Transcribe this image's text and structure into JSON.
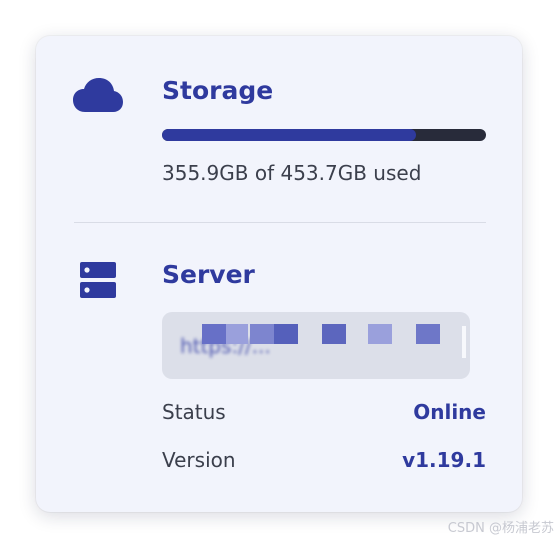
{
  "colors": {
    "accent": "#2f3a9e",
    "track": "#282b3a",
    "card_background": "#f2f4fc",
    "text": "#3b3f4c"
  },
  "storage": {
    "icon": "cloud-icon",
    "title": "Storage",
    "usage_text": "355.9GB of 453.7GB used",
    "used_percent": 78.4
  },
  "server": {
    "icon": "server-icon",
    "title": "Server",
    "url_blurred": "https://...",
    "status_label": "Status",
    "status_value": "Online",
    "version_label": "Version",
    "version_value": "v1.19.1"
  },
  "watermark": "CSDN @杨浦老苏"
}
